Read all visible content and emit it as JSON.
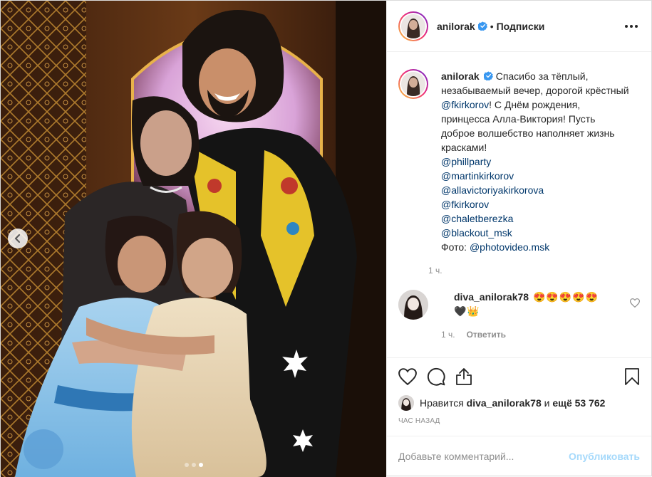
{
  "post": {
    "image_alt": "",
    "carousel": {
      "count": 3,
      "active": 1
    }
  },
  "header": {
    "username": "anilorak",
    "separator": "•",
    "follow_label": "Подписки",
    "more_icon": "more-horizontal-icon"
  },
  "caption": {
    "username": "anilorak",
    "text_before_mention": "Спасибо за тёплый, незабываемый вечер, дорогой крёстный ",
    "mention_main": "@fkirkorov",
    "text_after_mention": "! С Днём рождения, принцесса Алла-Виктория! Пусть доброе волшебство наполняет жизнь красками!",
    "mentions": [
      "@phillparty",
      "@martinkirkorov",
      "@allavictoriyakirkorova",
      "@fkirkorov",
      "@chaletberezka",
      "@blackout_msk"
    ],
    "photo_label": "Фото: ",
    "photo_mention": "@photovideo.msk",
    "time": "1 ч."
  },
  "comment": {
    "username": "diva_anilorak78",
    "emojis": "😍😍😍😍😍",
    "emojis_line2": "🖤👑",
    "time": "1 ч.",
    "reply_label": "Ответить"
  },
  "likes": {
    "prefix": "Нравится ",
    "user": "diva_anilorak78",
    "middle": " и ",
    "rest": "ещё 53 762"
  },
  "timestamp": "ЧАС НАЗАД",
  "add_comment": {
    "placeholder": "Добавьте комментарий...",
    "publish_label": "Опубликовать"
  },
  "colors": {
    "accent": "#0095f6",
    "mention": "#00376b",
    "muted": "#8e8e8e",
    "verified": "#3897f0"
  }
}
